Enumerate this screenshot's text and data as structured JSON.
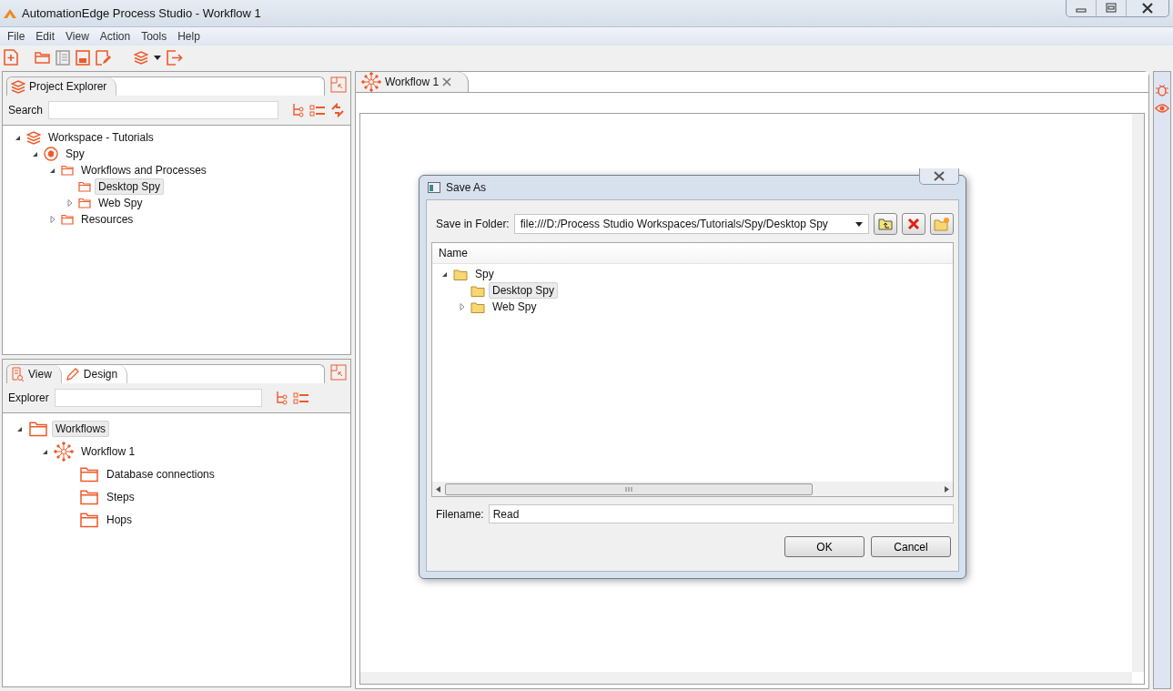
{
  "window": {
    "title": "AutomationEdge Process Studio - Workflow 1"
  },
  "menu": [
    "File",
    "Edit",
    "View",
    "Action",
    "Tools",
    "Help"
  ],
  "project_explorer": {
    "tabs": [
      {
        "label": "Project Explorer",
        "selected": true
      }
    ],
    "search_label": "Search",
    "tree": [
      {
        "label": "Workspace - Tutorials",
        "kind": "workspace",
        "expanded": true,
        "selected": false,
        "children": [
          {
            "label": "Spy",
            "kind": "project",
            "expanded": true,
            "selected": false,
            "children": [
              {
                "label": "Workflows and Processes",
                "kind": "folder",
                "expanded": true,
                "selected": false,
                "children": [
                  {
                    "label": "Desktop Spy",
                    "kind": "folder",
                    "selected": true
                  },
                  {
                    "label": "Web Spy",
                    "kind": "folder",
                    "expanded": false,
                    "selected": false
                  }
                ]
              },
              {
                "label": "Resources",
                "kind": "folder",
                "expanded": false,
                "selected": false
              }
            ]
          }
        ]
      }
    ]
  },
  "view_panel": {
    "tabs": [
      {
        "label": "View",
        "selected": true
      },
      {
        "label": "Design",
        "selected": false
      }
    ],
    "explorer_label": "Explorer",
    "tree": [
      {
        "label": "Workflows",
        "kind": "folder",
        "expanded": true,
        "selected": true,
        "children": [
          {
            "label": "Workflow 1",
            "kind": "workflow",
            "expanded": true,
            "selected": false,
            "children": [
              {
                "label": "Database connections",
                "kind": "folder",
                "selected": false
              },
              {
                "label": "Steps",
                "kind": "folder",
                "selected": false
              },
              {
                "label": "Hops",
                "kind": "folder",
                "selected": false
              }
            ]
          }
        ]
      }
    ]
  },
  "editor": {
    "tabs": [
      {
        "label": "Workflow 1",
        "selected": true
      }
    ]
  },
  "dialog": {
    "title": "Save As",
    "folder_label": "Save in Folder:",
    "folder_value": "file:///D:/Process Studio Workspaces/Tutorials/Spy/Desktop Spy",
    "list_header": "Name",
    "tree": [
      {
        "label": "Spy",
        "kind": "folder",
        "expanded": true,
        "selected": false,
        "children": [
          {
            "label": "Desktop Spy",
            "kind": "folder",
            "selected": true
          },
          {
            "label": "Web Spy",
            "kind": "folder",
            "expanded": false,
            "selected": false
          }
        ]
      }
    ],
    "filename_label": "Filename:",
    "filename_value": "Read",
    "buttons": [
      "OK",
      "Cancel"
    ]
  }
}
